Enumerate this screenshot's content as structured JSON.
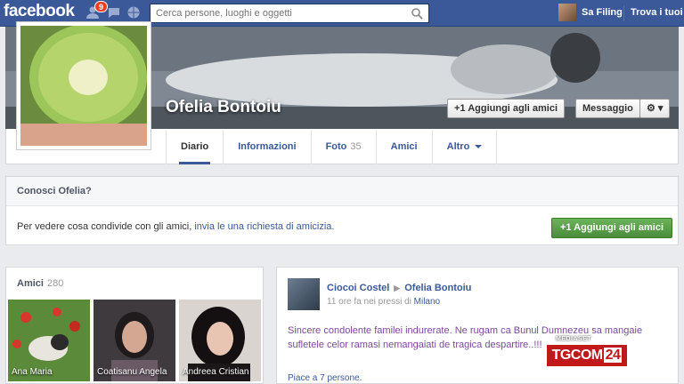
{
  "topbar": {
    "logo": "facebook",
    "notif_count": "9",
    "search_placeholder": "Cerca persone, luoghi e oggetti",
    "user_name": "Sa Filing",
    "find_friends": "Trova i tuoi"
  },
  "profile": {
    "name": "Ofelia Bontoiu",
    "add_friend": "+1 Aggiungi agli amici",
    "message": "Messaggio",
    "gear": "⚙ ▾"
  },
  "tabs": [
    {
      "label": "Diario",
      "count": ""
    },
    {
      "label": "Informazioni",
      "count": ""
    },
    {
      "label": "Foto",
      "count": "35"
    },
    {
      "label": "Amici",
      "count": ""
    },
    {
      "label": "Altro",
      "count": ""
    }
  ],
  "know": {
    "title": "Conosci Ofelia?",
    "text": "Per vedere cosa condivide con gli amici, ",
    "link": "invia le una richiesta di amicizia.",
    "button": "+1 Aggiungi agli amici"
  },
  "friends": {
    "title": "Amici",
    "count": "280",
    "items": [
      {
        "name": "Ana Maria"
      },
      {
        "name": "Coatisanu Angela"
      },
      {
        "name": "Andreea Cristian"
      }
    ]
  },
  "post": {
    "author": "Ciocoi Costel",
    "target": "Ofelia Bontoiu",
    "meta": "11 ore fa nei pressi di ",
    "place": "Milano",
    "body": "Sincere condolente familei indurerate. Ne rugam ca Bunul Dumnezeu sa mangaie sufletele celor ramasi nemangaiati de tragica despartire..!!!",
    "likes": "Piace a 7 persone."
  },
  "overlay": {
    "logo_text": "TGCOM",
    "logo_num": "24",
    "brand": "MEDIASET"
  }
}
